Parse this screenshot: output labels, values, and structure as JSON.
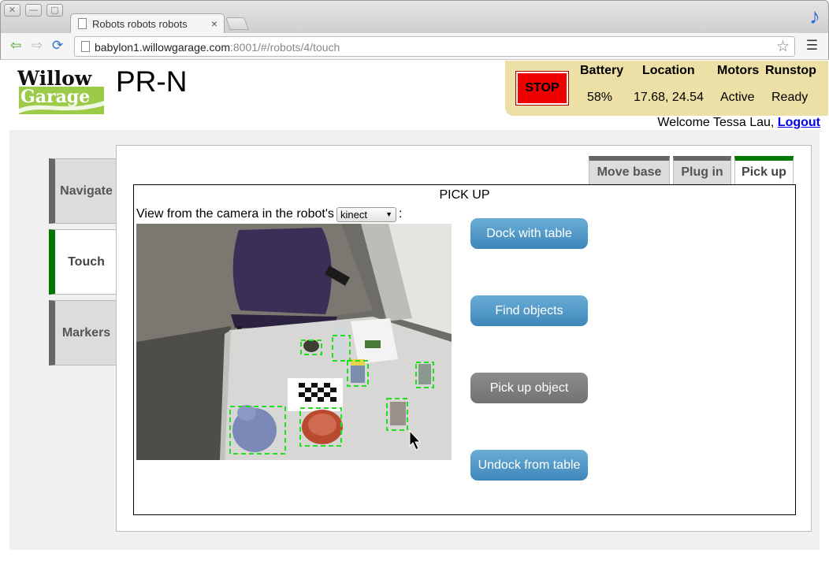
{
  "browser": {
    "tab_title": "Robots robots robots",
    "url_host": "babylon1.willowgarage.com",
    "url_path": ":8001/#/robots/4/touch"
  },
  "header": {
    "logo_line1": "Willow",
    "logo_line2": "Garage",
    "robot_name": "PR-N"
  },
  "status": {
    "stop_label": "STOP",
    "battery_label": "Battery",
    "battery_value": "58%",
    "location_label": "Location",
    "location_value": "17.68, 24.54",
    "motors_label": "Motors",
    "motors_value": "Active",
    "runstop_label": "Runstop",
    "runstop_value": "Ready"
  },
  "user": {
    "welcome": "Welcome Tessa Lau,",
    "logout": "Logout"
  },
  "side_tabs": [
    {
      "label": "Navigate",
      "active": false
    },
    {
      "label": "Touch",
      "active": true
    },
    {
      "label": "Markers",
      "active": false
    }
  ],
  "top_tabs": [
    {
      "label": "Move base",
      "active": false
    },
    {
      "label": "Plug in",
      "active": false
    },
    {
      "label": "Pick up",
      "active": true
    }
  ],
  "pick": {
    "title": "PICK UP",
    "camera_label": "View from the camera in the robot's",
    "camera_selected": "kinect",
    "colon": ":"
  },
  "actions": [
    {
      "label": "Dock with table",
      "style": "blue"
    },
    {
      "label": "Find objects",
      "style": "blue"
    },
    {
      "label": "Pick up object",
      "style": "grey"
    },
    {
      "label": "Undock from table",
      "style": "blue"
    }
  ],
  "colors": {
    "status_bg": "#ece0a6",
    "stop": "#ee0000",
    "active_tab": "#007700",
    "inactive_tab": "#666666",
    "button_blue": "#4f96c6",
    "button_grey": "#7f7f7f"
  }
}
